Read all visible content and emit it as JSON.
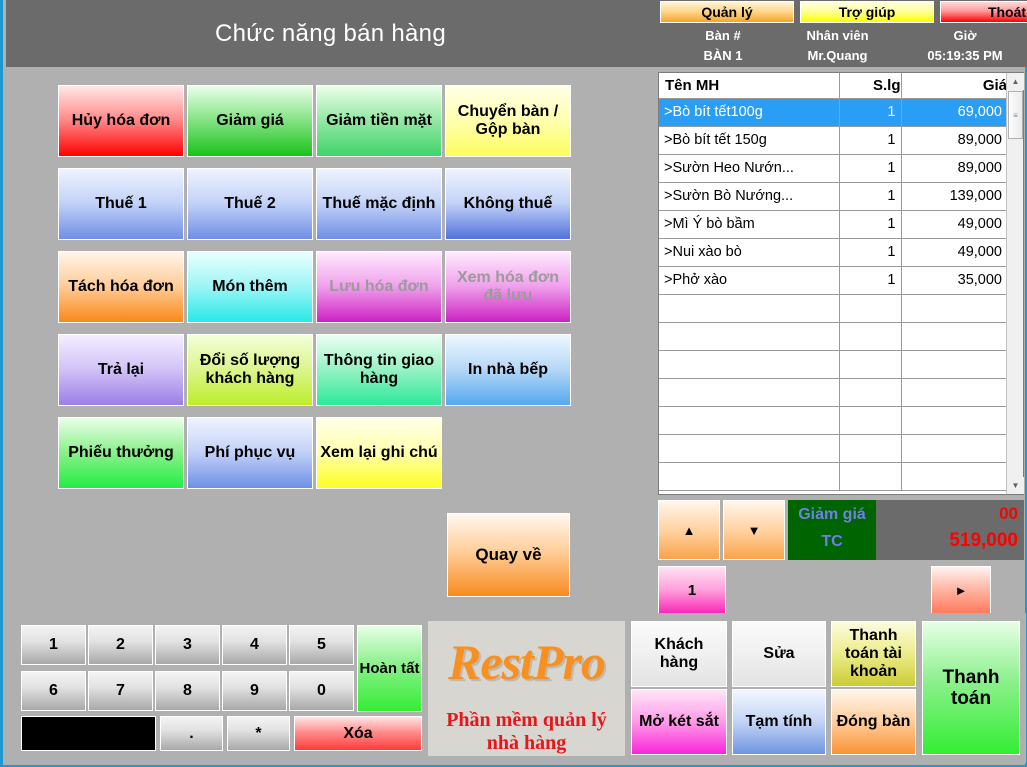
{
  "header": {
    "title": "Chức năng bán hàng",
    "top_buttons": [
      {
        "name": "manage",
        "label": "Quản lý"
      },
      {
        "name": "help",
        "label": "Trợ giúp"
      },
      {
        "name": "exit",
        "label": "Thoát"
      }
    ],
    "info": {
      "table_label": "Bàn #",
      "table_value": "BÀN 1",
      "staff_label": "Nhân viên",
      "staff_value": "Mr.Quang",
      "time_label": "Giờ",
      "time_value": "05:19:35 PM"
    }
  },
  "functions": [
    {
      "label": "Hủy hóa đơn",
      "color_from": "#ffe7e7",
      "color_mid": "#ff8a8a",
      "color_to": "#ff0000",
      "disabled": false
    },
    {
      "label": "Giảm giá",
      "color_from": "#eaffea",
      "color_mid": "#86e386",
      "color_to": "#19c219",
      "disabled": false
    },
    {
      "label": "Giảm tiền mặt",
      "color_from": "#eaffea",
      "color_mid": "#95e8a5",
      "color_to": "#3fd46a",
      "disabled": false
    },
    {
      "label": "Chuyển bàn / Gộp bàn",
      "color_from": "#ffffe8",
      "color_mid": "#ffffb0",
      "color_to": "#fdfd5e",
      "disabled": false
    },
    {
      "label": "Thuế 1",
      "color_from": "#eef3ff",
      "color_mid": "#c3d2f7",
      "color_to": "#6f8fe6",
      "disabled": false
    },
    {
      "label": "Thuế 2",
      "color_from": "#eef3ff",
      "color_mid": "#c3d2f7",
      "color_to": "#6f8fe6",
      "disabled": false
    },
    {
      "label": "Thuế mặc định",
      "color_from": "#eef3ff",
      "color_mid": "#c3d2f7",
      "color_to": "#6f8fe6",
      "disabled": false
    },
    {
      "label": "Không thuế",
      "color_from": "#eef3ff",
      "color_mid": "#c3d2f7",
      "color_to": "#5272de",
      "disabled": false
    },
    {
      "label": "Tách hóa đơn",
      "color_from": "#fff5ea",
      "color_mid": "#ffcd99",
      "color_to": "#f9881a",
      "disabled": false
    },
    {
      "label": "Món thêm",
      "color_from": "#eaffff",
      "color_mid": "#9ff5f5",
      "color_to": "#2ae8e8",
      "disabled": false
    },
    {
      "label": "Lưu hóa đơn",
      "color_from": "#ffeaff",
      "color_mid": "#f0a2ec",
      "color_to": "#cc22c2",
      "disabled": true
    },
    {
      "label": "Xem hóa đơn đã lưu",
      "color_from": "#ffeaff",
      "color_mid": "#f0a2ec",
      "color_to": "#cc22c2",
      "disabled": true
    },
    {
      "label": "Trả lại",
      "color_from": "#f4eeff",
      "color_mid": "#d3c3f7",
      "color_to": "#9b7fe6",
      "disabled": false
    },
    {
      "label": "Đổi số lượng khách hàng",
      "color_from": "#f3ffd9",
      "color_mid": "#dcf58e",
      "color_to": "#bcee2a",
      "disabled": false
    },
    {
      "label": "Thông tin giao hàng",
      "color_from": "#eafff2",
      "color_mid": "#98f2c4",
      "color_to": "#2ee89a",
      "disabled": false
    },
    {
      "label": "In nhà bếp",
      "color_from": "#eef7ff",
      "color_mid": "#b6d8f7",
      "color_to": "#55a8ee",
      "disabled": false
    },
    {
      "label": "Phiếu thưởng",
      "color_from": "#eaffea",
      "color_mid": "#8cf08c",
      "color_to": "#22ee44",
      "disabled": false
    },
    {
      "label": "Phí phục vụ",
      "color_from": "#eef3ff",
      "color_mid": "#c3d2f7",
      "color_to": "#6f8fe6",
      "disabled": false
    },
    {
      "label": "Xem lại ghi chú",
      "color_from": "#ffffe8",
      "color_mid": "#ffffae",
      "color_to": "#fdfd25",
      "disabled": false
    }
  ],
  "back_button": {
    "label": "Quay về"
  },
  "order": {
    "columns": [
      "Tên MH",
      "S.lg",
      "Giá"
    ],
    "rows": [
      {
        "name": ">Bò bít tết100g",
        "qty": "1",
        "price": "69,000",
        "selected": true
      },
      {
        "name": ">Bò bít tết 150g",
        "qty": "1",
        "price": "89,000",
        "selected": false
      },
      {
        "name": ">Sườn Heo Nướn...",
        "qty": "1",
        "price": "89,000",
        "selected": false
      },
      {
        "name": ">Sườn Bò Nướng...",
        "qty": "1",
        "price": "139,000",
        "selected": false
      },
      {
        "name": ">Mì Ý bò bầm",
        "qty": "1",
        "price": "49,000",
        "selected": false
      },
      {
        "name": ">Nui xào bò",
        "qty": "1",
        "price": "49,000",
        "selected": false
      },
      {
        "name": ">Phở xào",
        "qty": "1",
        "price": "35,000",
        "selected": false
      },
      {
        "name": "",
        "qty": "",
        "price": "",
        "selected": false
      },
      {
        "name": "",
        "qty": "",
        "price": "",
        "selected": false
      },
      {
        "name": "",
        "qty": "",
        "price": "",
        "selected": false
      },
      {
        "name": "",
        "qty": "",
        "price": "",
        "selected": false
      },
      {
        "name": "",
        "qty": "",
        "price": "",
        "selected": false
      },
      {
        "name": "",
        "qty": "",
        "price": "",
        "selected": false
      },
      {
        "name": "",
        "qty": "",
        "price": "",
        "selected": false
      }
    ],
    "scroll_up_icon": "▲",
    "scroll_down_icon": "▼",
    "scroll_thumb_icon": "≡"
  },
  "totals": {
    "nav_up_icon": "▲",
    "nav_down_icon": "▼",
    "discount_label": "Giảm giá",
    "discount_value": "00",
    "total_label": "TC",
    "total_value": "519,000",
    "qty_value": "1",
    "forward_icon": "►",
    "green_bg": "#006400",
    "label_color": "#6f7fe8",
    "value_color": "#ff0000"
  },
  "keypad": {
    "keys_row1": [
      "1",
      "2",
      "3",
      "4",
      "5"
    ],
    "keys_row2": [
      "6",
      "7",
      "8",
      "9",
      "0"
    ],
    "done_label": "Hoàn tất",
    "display_value": "",
    "dot_label": ".",
    "star_label": "*",
    "clear_label": "Xóa"
  },
  "logo": {
    "main": "RestPro",
    "sub": "Phần mềm quản lý nhà hàng",
    "main_color": "#f79020",
    "sub_color": "#e8161b"
  },
  "actions": [
    {
      "name": "customer",
      "label": "Khách hàng"
    },
    {
      "name": "edit",
      "label": "Sửa"
    },
    {
      "name": "account-payment",
      "label": "Thanh toán tài khoản"
    },
    {
      "name": "open-cash-drawer",
      "label": "Mở két sắt"
    },
    {
      "name": "subtotal",
      "label": "Tạm tính"
    },
    {
      "name": "close-table",
      "label": "Đóng bàn"
    },
    {
      "name": "pay",
      "label": "Thanh toán"
    }
  ]
}
